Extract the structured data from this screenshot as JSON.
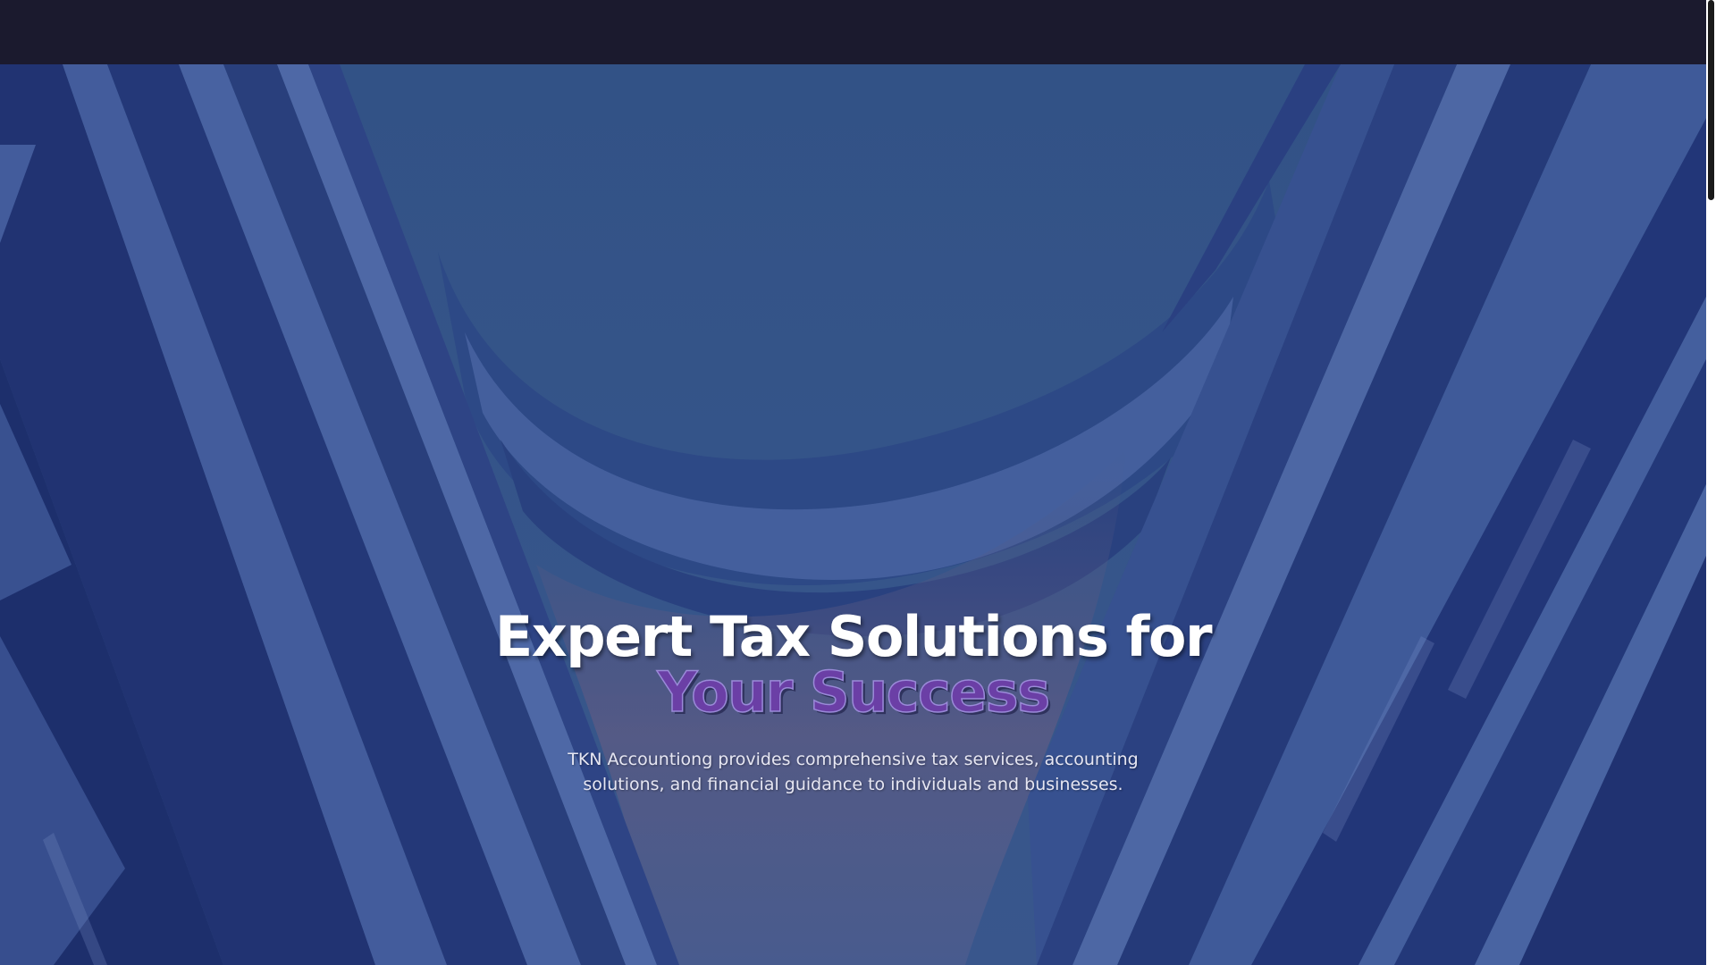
{
  "hero": {
    "title_main": "Expert Tax Solutions for ",
    "title_accent": "Your Success",
    "subtitle": "TKN Accountiong provides comprehensive tax services, accounting solutions, and financial guidance to individuals and businesses."
  },
  "colors": {
    "topbar": "#1b1a2e",
    "hero_sky": "#34578a",
    "building_dark": "#1c2c68",
    "building_light": "#4a68a8",
    "title_accent": "#6b3fa6"
  },
  "icons": {
    "scrollbar": "scrollbar-thumb"
  }
}
